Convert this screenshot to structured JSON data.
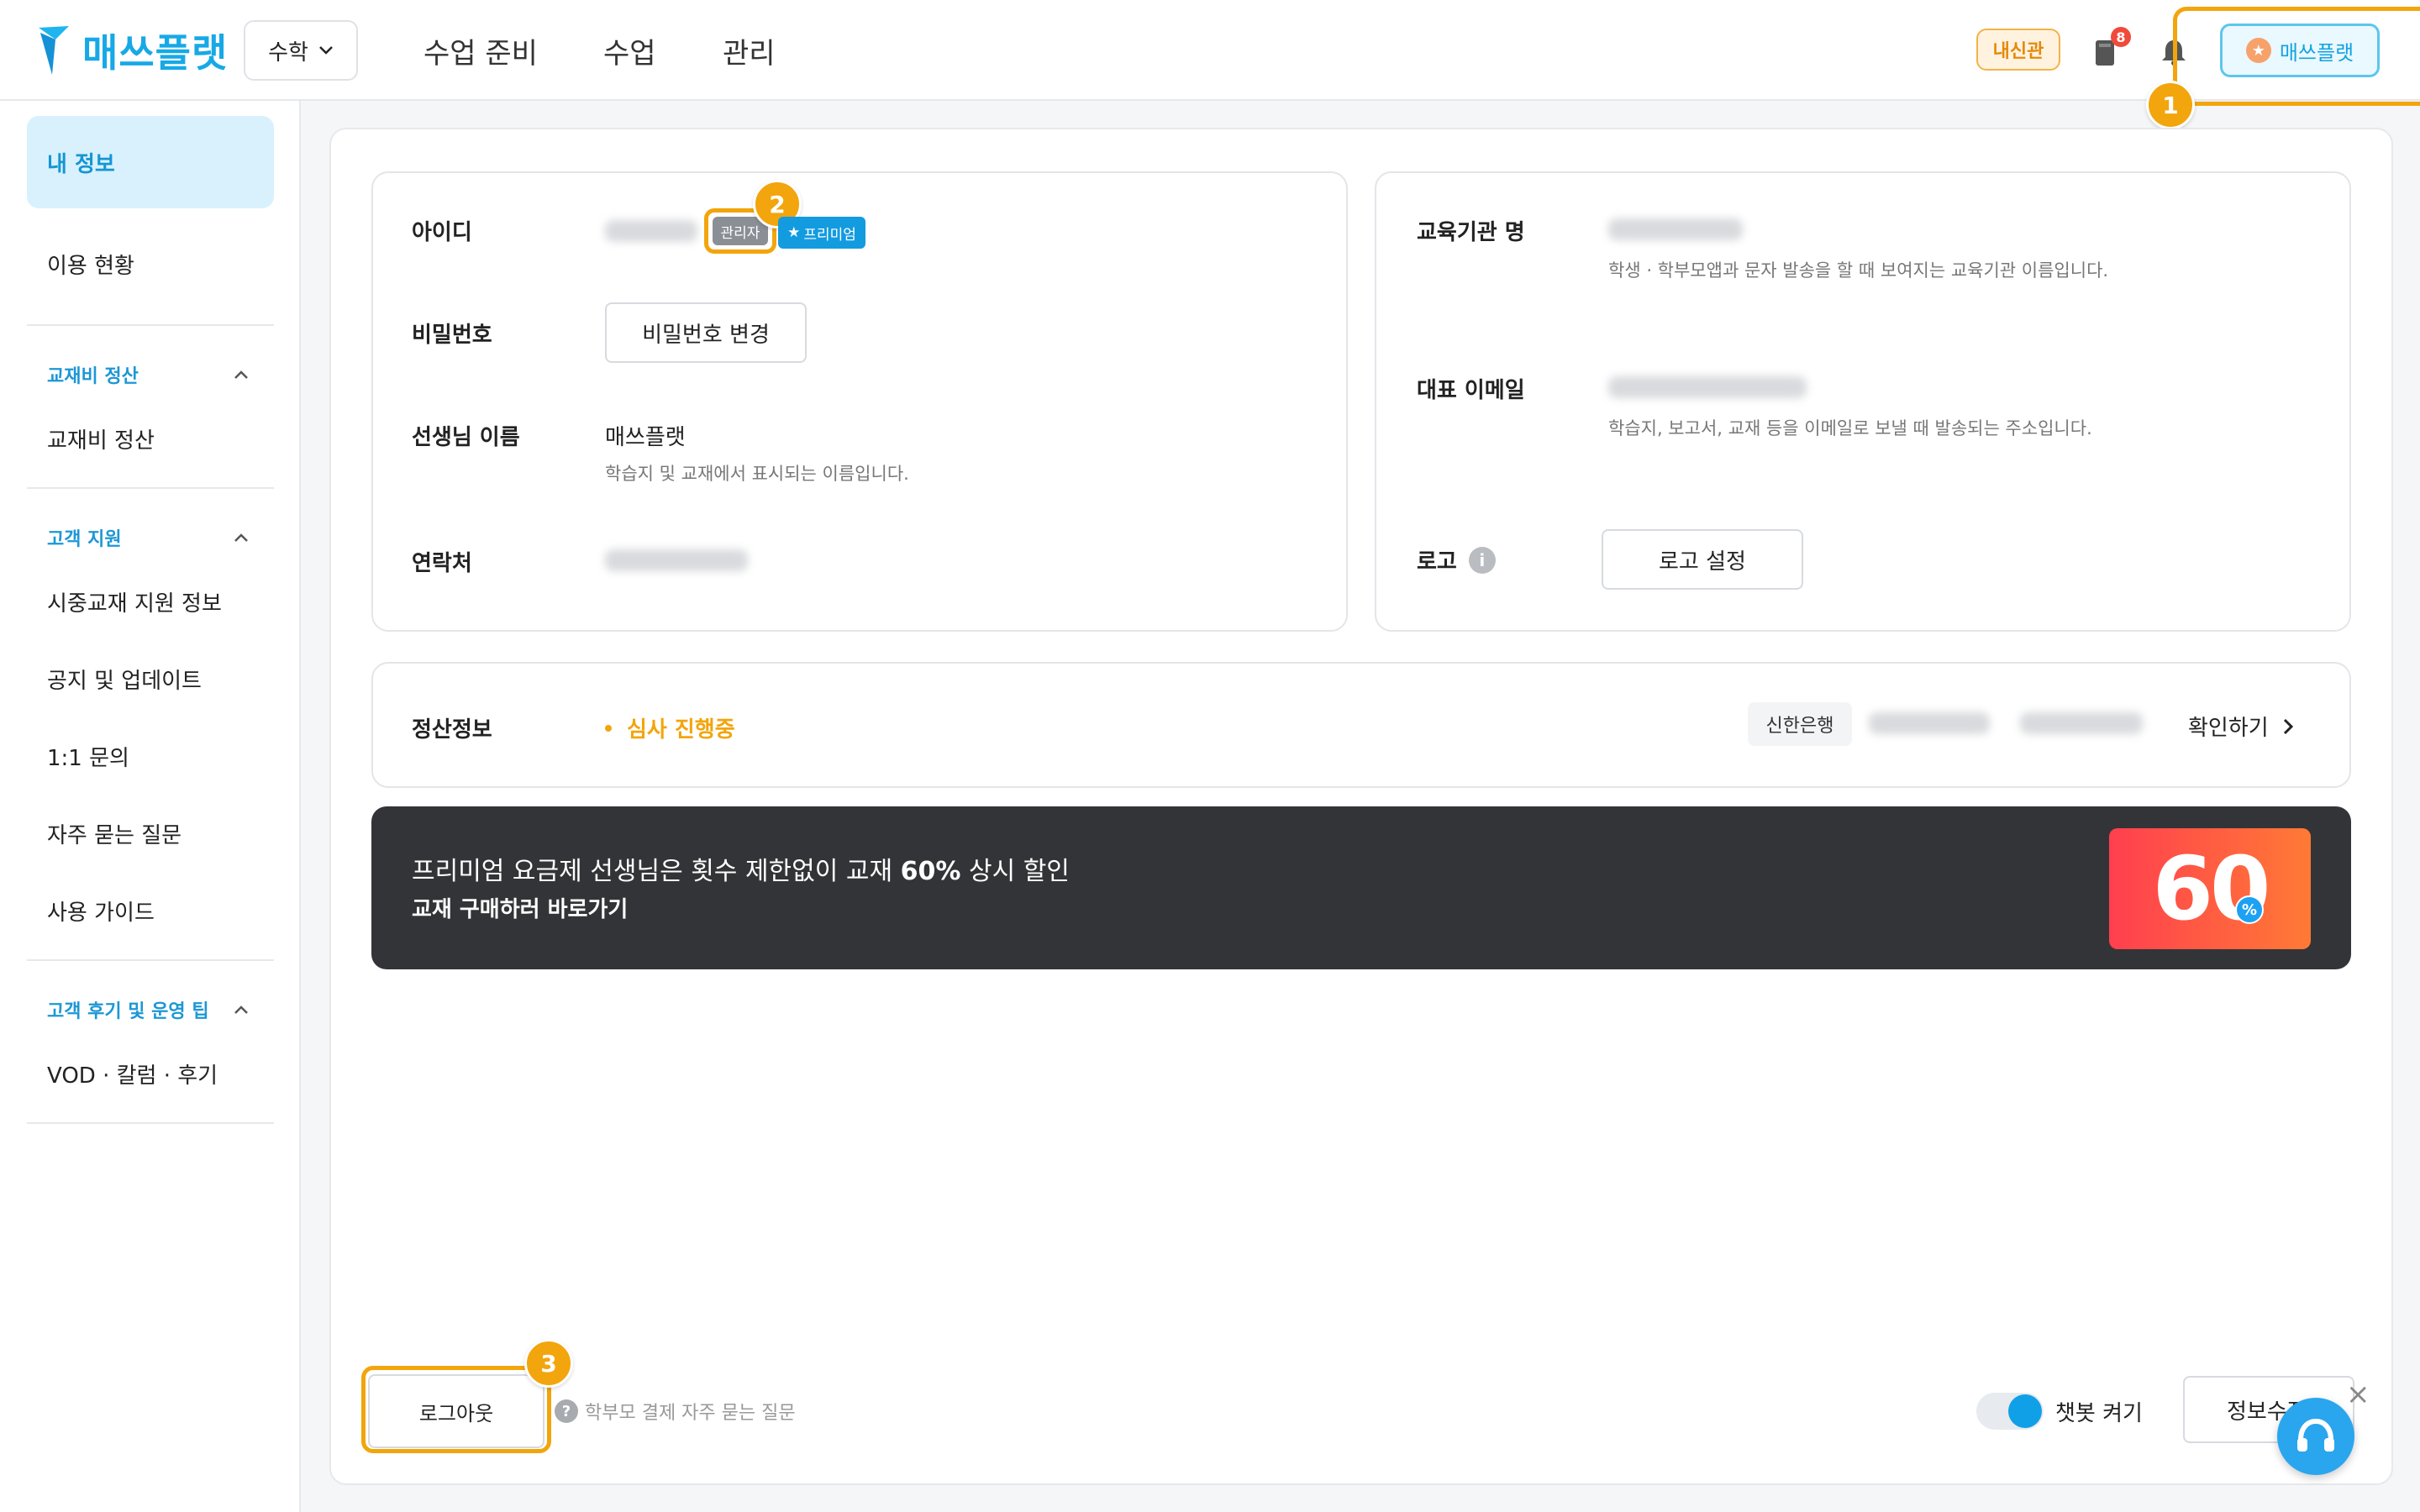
{
  "header": {
    "logo_text": "매쓰플랫",
    "subject": "수학",
    "nav": [
      "수업 준비",
      "수업",
      "관리"
    ],
    "naesin": "내신관",
    "book_badge": "8",
    "profile_name": "매쓰플랫"
  },
  "sidebar": {
    "my_info": "내 정보",
    "usage": "이용 현황",
    "sections": [
      {
        "title": "교재비 정산",
        "items": [
          "교재비 정산"
        ]
      },
      {
        "title": "고객 지원",
        "items": [
          "시중교재 지원 정보",
          "공지 및 업데이트",
          "1:1 문의",
          "자주 묻는 질문",
          "사용 가이드"
        ]
      },
      {
        "title": "고객 후기 및 운영 팁",
        "items": [
          "VOD · 칼럼 · 후기"
        ]
      }
    ]
  },
  "account": {
    "id_label": "아이디",
    "tag_admin": "관리자",
    "tag_premium": "프리미엄",
    "password_label": "비밀번호",
    "password_button": "비밀번호 변경",
    "teacher_label": "선생님 이름",
    "teacher_name": "매쓰플랫",
    "teacher_desc": "학습지 및 교재에서 표시되는 이름입니다.",
    "contact_label": "연락처"
  },
  "institution": {
    "name_label": "교육기관 명",
    "name_desc": "학생 · 학부모앱과 문자 발송을 할 때 보여지는 교육기관 이름입니다.",
    "email_label": "대표 이메일",
    "email_desc": "학습지, 보고서, 교재 등을 이메일로 보낼 때 발송되는 주소입니다.",
    "logo_label": "로고",
    "logo_button": "로고 설정"
  },
  "settlement": {
    "label": "정산정보",
    "status": "심사 진행중",
    "bank": "신한은행",
    "confirm": "확인하기"
  },
  "banner": {
    "text_before": "프리미엄 요금제 선생님은 횟수 제한없이 교재 ",
    "text_bold": "60%",
    "text_after": " 상시 할인",
    "sub": "교재 구매하러 바로가기",
    "img_num": "60",
    "img_pct": "%"
  },
  "footer": {
    "logout": "로그아웃",
    "faq": "학부모 결제 자주 묻는 질문",
    "chatbot": "챗봇 켜기",
    "info_button": "정보수정"
  },
  "annotations": [
    "1",
    "2",
    "3"
  ],
  "colors": {
    "accent": "#17a9e6",
    "highlight": "#f2a50c",
    "status_pending": "#f2a50c",
    "banner_bg": "#333437"
  }
}
